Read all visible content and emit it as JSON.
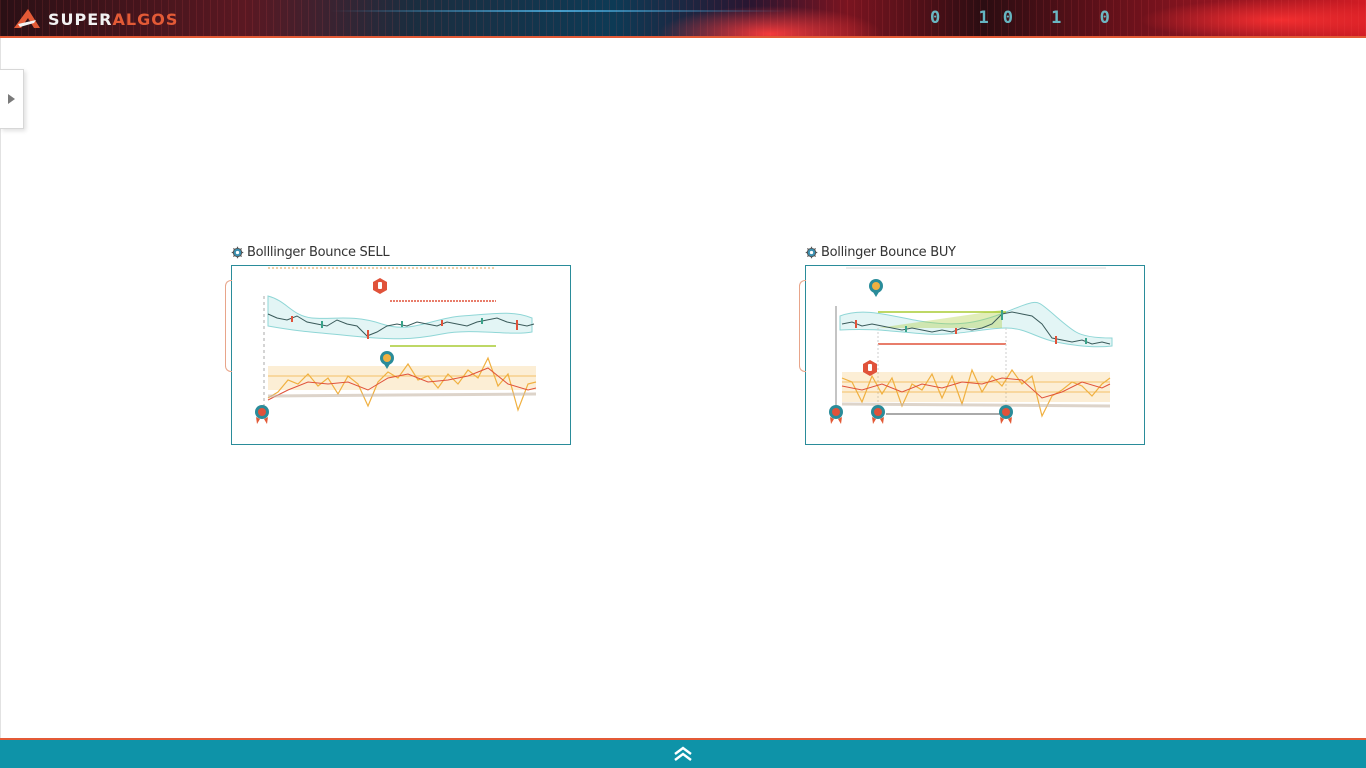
{
  "app": {
    "logo": {
      "text_primary": "SUPER",
      "text_accent": "ALGOS"
    },
    "banner_binary": "0 10 1 0"
  },
  "side_panel": {
    "toggle_icon": "triangle-right-icon"
  },
  "strategies": [
    {
      "title": "Bolllinger Bounce SELL",
      "icon": "gear-icon",
      "chart_type": "line",
      "markers": [
        "take-profit-hand-icon",
        "stop-loss-hand-icon",
        "start-badge-icon"
      ]
    },
    {
      "title": "Bollinger Bounce BUY",
      "icon": "gear-icon",
      "chart_type": "line",
      "markers": [
        "take-profit-hand-icon",
        "stop-loss-hand-icon",
        "start-badge-icon",
        "start-badge-icon",
        "start-badge-icon"
      ]
    }
  ],
  "footer": {
    "icon": "double-chevron-up-icon"
  },
  "colors": {
    "brand_accent": "#e35a36",
    "frame": "#2a8c9a",
    "footer_bg": "#0e93a8",
    "candle_up": "#3aa38a",
    "candle_down": "#e0523a",
    "band": "#8fd6d6",
    "oscillator": "#f0b040",
    "green_line": "#a8cc33",
    "red_line": "#e0523a"
  }
}
